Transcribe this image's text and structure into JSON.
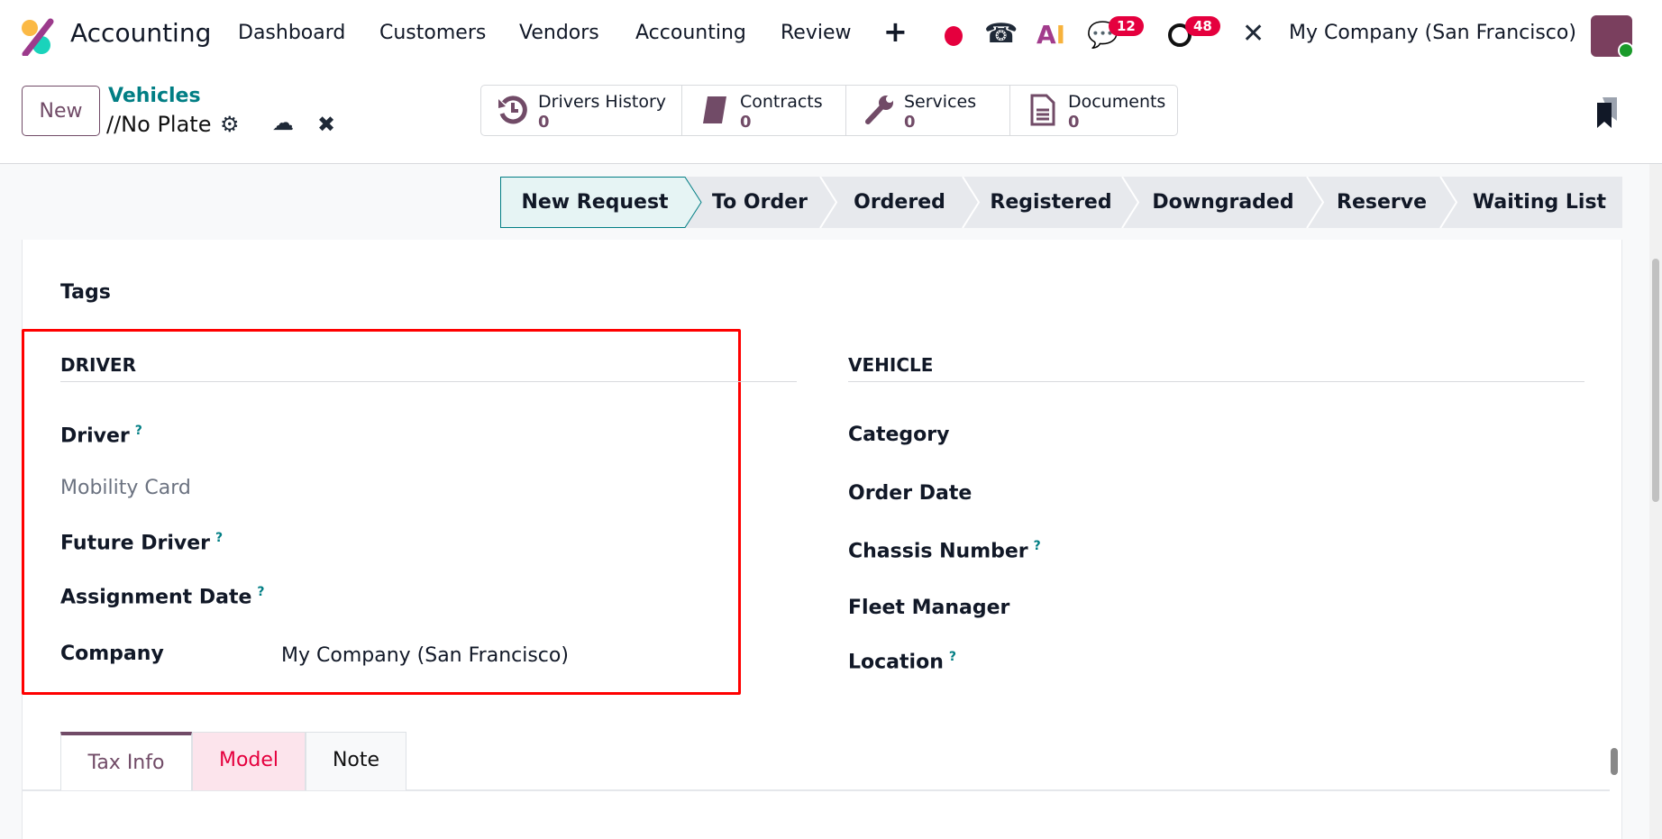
{
  "nav": {
    "app_name": "Accounting",
    "menu": [
      "Dashboard",
      "Customers",
      "Vendors",
      "Accounting",
      "Review"
    ],
    "messages_badge": "12",
    "activities_badge": "48",
    "company": "My Company (San Francisco)"
  },
  "control": {
    "new_label": "New",
    "breadcrumb_parent": "Vehicles",
    "breadcrumb_current": "//No Plate"
  },
  "stats": [
    {
      "label": "Drivers History",
      "count": "0"
    },
    {
      "label": "Contracts",
      "count": "0"
    },
    {
      "label": "Services",
      "count": "0"
    },
    {
      "label": "Documents",
      "count": "0"
    }
  ],
  "stages": [
    "New Request",
    "To Order",
    "Ordered",
    "Registered",
    "Downgraded",
    "Reserve",
    "Waiting List"
  ],
  "form": {
    "tags_label": "Tags",
    "driver": {
      "heading": "DRIVER",
      "driver": "Driver",
      "mobility_card": "Mobility Card",
      "future_driver": "Future Driver",
      "assignment_date": "Assignment Date",
      "company": "Company",
      "company_value": "My Company (San Francisco)",
      "help": "?"
    },
    "vehicle": {
      "heading": "VEHICLE",
      "category": "Category",
      "order_date": "Order Date",
      "chassis_number": "Chassis Number",
      "fleet_manager": "Fleet Manager",
      "location": "Location",
      "help": "?"
    }
  },
  "tabs": [
    "Tax Info",
    "Model",
    "Note"
  ],
  "colors": {
    "brand": "#714b67",
    "teal": "#017e84",
    "badge": "#e5003e",
    "highlight": "#ff0000"
  }
}
